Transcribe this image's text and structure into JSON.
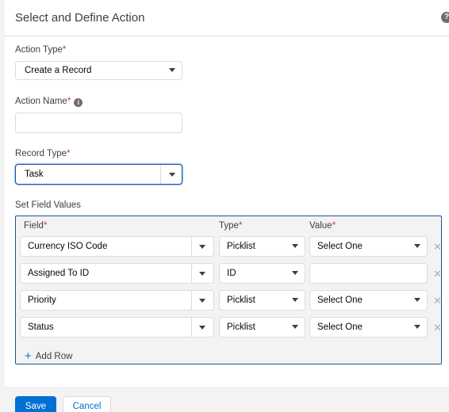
{
  "header": {
    "title": "Select and Define Action",
    "help_icon": "question-icon"
  },
  "action_type": {
    "label": "Action Type",
    "value": "Create a Record"
  },
  "action_name": {
    "label": "Action Name",
    "value": "",
    "info_icon": "info-icon"
  },
  "record_type": {
    "label": "Record Type",
    "value": "Task"
  },
  "set_field_values": {
    "label": "Set Field Values",
    "columns": {
      "field": "Field",
      "type": "Type",
      "value": "Value"
    },
    "rows": [
      {
        "field": "Currency ISO Code",
        "type": "Picklist",
        "value": "Select One"
      },
      {
        "field": "Assigned To ID",
        "type": "ID",
        "value": ""
      },
      {
        "field": "Priority",
        "type": "Picklist",
        "value": "Select One"
      },
      {
        "field": "Status",
        "type": "Picklist",
        "value": "Select One"
      }
    ],
    "add_row_label": "Add Row"
  },
  "required_marker": "*",
  "buttons": {
    "save": "Save",
    "cancel": "Cancel"
  },
  "colors": {
    "brand": "#0070d2",
    "focus_border": "#1b5297",
    "required": "#c23934",
    "border": "#dddbda"
  }
}
